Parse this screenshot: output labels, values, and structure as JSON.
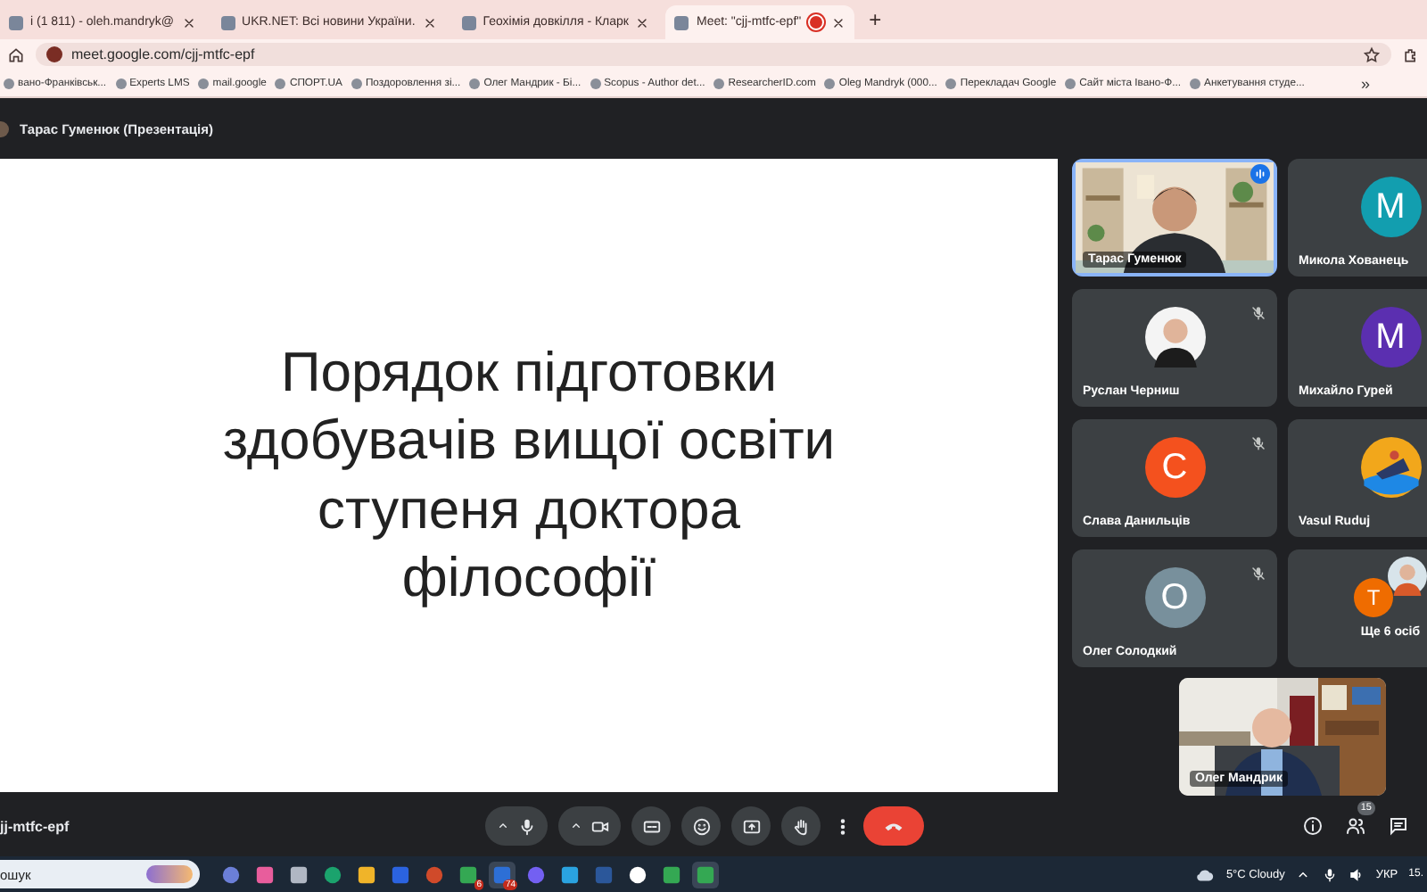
{
  "browser": {
    "tabs": [
      {
        "title": "і (1 811) - oleh.mandryk@",
        "selected": false,
        "recording": false
      },
      {
        "title": "UKR.NET: Всі новини України.",
        "selected": false,
        "recording": false
      },
      {
        "title": "Геохімія довкілля - Кларк",
        "selected": false,
        "recording": false
      },
      {
        "title": "Meet: \"cjj-mtfc-epf\"",
        "selected": true,
        "recording": true
      }
    ],
    "new_tab": "+",
    "address": "meet.google.com/cjj-mtfc-epf",
    "bookmarks": [
      "вано-Франківськ...",
      "Experts LMS",
      "mail.google",
      "СПОРТ.UA",
      "Поздоровлення зі...",
      "Олег Мандрик - Бі...",
      "Scopus - Author det...",
      "ResearcherID.com",
      "Oleg Mandryk (000...",
      "Перекладач Google",
      "Сайт міста Івано-Ф...",
      "Анкетування студе..."
    ],
    "bookmarks_more": "»"
  },
  "meet": {
    "presenter": "Тарас Гуменюк (Презентація)",
    "slide": {
      "title": "Порядок підготовки\nздобувачів вищої освіти\nступеня доктора\nфілософії"
    },
    "tiles": [
      {
        "kind": "video",
        "name": "Тарас Гуменюк",
        "speaking": true,
        "muted": false
      },
      {
        "kind": "letter",
        "initial": "M",
        "color": "#129eaf",
        "name": "Микола Хованець",
        "speaking": false
      },
      {
        "name": "Руслан Черниш",
        "speaking": false,
        "muted": true
      },
      {
        "kind": "letter",
        "initial": "M",
        "color": "#5b2fb0",
        "name": "Михайло Гурей",
        "speaking": false
      },
      {
        "kind": "letter",
        "initial": "C",
        "color": "#f4511e",
        "name": "Слава Данильців",
        "speaking": false,
        "muted": true
      },
      {
        "name": "Vasul Ruduj",
        "speaking": false
      },
      {
        "kind": "letter",
        "initial": "O",
        "color": "#78909c",
        "name": "Олег Солодкий",
        "speaking": false,
        "muted": true
      },
      {
        "kind": "more",
        "initial": "T",
        "color": "#ef6c00",
        "name": "Ще 6 осіб",
        "speaking": false
      }
    ],
    "self_view": {
      "name": "Олег Мандрик"
    },
    "meeting_code": "jj-mtfc-epf",
    "participants_badge": "15"
  },
  "taskbar": {
    "search": "ошук",
    "app_badges": [
      "6",
      "74"
    ],
    "weather": "5°C Cloudy",
    "language": "УКР",
    "clock": "15."
  }
}
